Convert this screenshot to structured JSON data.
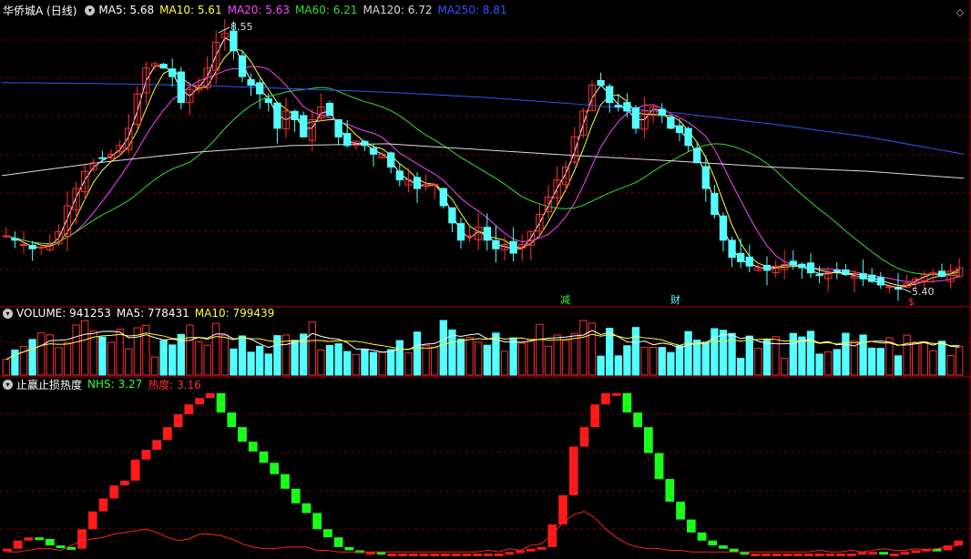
{
  "header": {
    "stock_name": "华侨城A (日线)",
    "ma": [
      {
        "label": "MA5: 5.68",
        "color": "#ffffff"
      },
      {
        "label": "MA10: 5.61",
        "color": "#ffff33"
      },
      {
        "label": "MA20: 5.63",
        "color": "#ff44ff"
      },
      {
        "label": "MA60: 6.21",
        "color": "#33dd33"
      },
      {
        "label": "MA120: 6.72",
        "color": "#dddddd"
      },
      {
        "label": "MA250: 8.81",
        "color": "#3355ff"
      }
    ]
  },
  "volume_header": {
    "label": "VOLUME: 941253",
    "ma5": "MA5: 778431",
    "ma10": "MA10: 799439"
  },
  "indicator_header": {
    "name": "止赢止损热度",
    "nhs": "NHS: 3.27",
    "heat": "热度: 3.16"
  },
  "annotations": {
    "high": "8.55",
    "low": "5.40",
    "event_1": "减",
    "event_2": "财",
    "event_3": "$"
  },
  "colors": {
    "up": "#ff3030",
    "down": "#54ffff",
    "grid": "#7a0000",
    "nhs_up": "#ff1a1a",
    "nhs_down": "#1aff1a",
    "heat": "#ff2020"
  },
  "icons": {
    "settings": "circle-chevron-icon",
    "corner": "diamond-icon"
  },
  "chart_data": [
    {
      "type": "candlestick",
      "title": "华侨城A (日线)",
      "ylim": [
        5.3,
        8.6
      ],
      "price_path": [
        6.05,
        6.0,
        5.95,
        5.9,
        5.92,
        5.95,
        6.1,
        6.4,
        6.6,
        6.8,
        6.9,
        6.95,
        7.0,
        7.1,
        7.3,
        7.7,
        8.0,
        8.05,
        8.0,
        7.9,
        7.6,
        7.75,
        7.8,
        8.0,
        8.3,
        8.4,
        8.2,
        7.9,
        7.8,
        7.7,
        7.6,
        7.3,
        7.5,
        7.4,
        7.2,
        7.4,
        7.55,
        7.45,
        7.2,
        7.1,
        7.15,
        7.1,
        7.0,
        7.0,
        6.85,
        6.7,
        6.7,
        6.6,
        6.65,
        6.65,
        6.4,
        6.2,
        6.0,
        6.05,
        6.15,
        6.0,
        5.9,
        5.95,
        5.85,
        5.95,
        6.1,
        6.3,
        6.5,
        6.7,
        6.85,
        7.2,
        7.5,
        7.8,
        7.8,
        7.6,
        7.55,
        7.5,
        7.3,
        7.5,
        7.55,
        7.45,
        7.3,
        7.25,
        7.1,
        6.9,
        6.6,
        6.3,
        6.0,
        5.8,
        5.75,
        5.7,
        5.68,
        5.65,
        5.7,
        5.72,
        5.71,
        5.68,
        5.62,
        5.6,
        5.62,
        5.64,
        5.6,
        5.58,
        5.55,
        5.52,
        5.48,
        5.46,
        5.44,
        5.5,
        5.55,
        5.6,
        5.62,
        5.58,
        5.64,
        5.68
      ],
      "high": 8.55,
      "low": 5.4
    },
    {
      "type": "bar",
      "title": "VOLUME",
      "values_latest": 941253,
      "ma5": 778431,
      "ma10": 799439
    },
    {
      "type": "line",
      "title": "止赢止损热度",
      "series": [
        {
          "name": "NHS",
          "values": [
            0.3,
            0.8,
            1.0,
            0.9,
            0.5,
            0.4,
            0.3,
            1.5,
            2.6,
            3.4,
            4.2,
            4.5,
            5.8,
            6.4,
            7.0,
            7.8,
            8.6,
            9.2,
            9.6,
            9.9,
            8.7,
            7.8,
            6.9,
            6.3,
            5.6,
            4.9,
            4.0,
            3.1,
            2.5,
            1.5,
            1.0,
            0.4,
            0.2,
            0.1,
            0.1,
            0.0,
            0.0,
            0.0,
            0.0,
            0.0,
            0.0,
            0.0,
            0.0,
            0.0,
            0.0,
            0.0,
            0.0,
            0.1,
            0.2,
            0.3,
            0.4,
            1.8,
            3.6,
            6.6,
            7.8,
            9.2,
            9.9,
            9.9,
            8.7,
            7.8,
            6.2,
            4.6,
            3.2,
            2.1,
            1.3,
            0.8,
            0.5,
            0.3,
            0.1,
            0.0,
            0.0,
            0.0,
            0.0,
            0.0,
            0.0,
            0.0,
            0.0,
            0.0,
            0.0,
            0.0,
            0.1,
            0.1,
            0.0,
            0.0,
            0.1,
            0.2,
            0.3,
            0.2,
            0.5,
            0.8
          ]
        },
        {
          "name": "热度",
          "values": [
            0.1,
            0.1,
            0.2,
            0.3,
            0.3,
            0.2,
            0.5,
            0.8,
            0.9,
            1.0,
            1.2,
            1.3,
            1.4,
            1.5,
            1.3,
            1.0,
            0.8,
            0.9,
            1.2,
            1.2,
            1.1,
            0.9,
            0.6,
            0.4,
            0.3,
            0.3,
            0.4,
            0.4,
            0.4,
            0.2,
            0.2,
            0.1,
            0.1,
            0.1,
            0.1,
            0.1,
            0.1,
            0.1,
            0.1,
            0.1,
            0.1,
            0.1,
            0.1,
            0.1,
            0.1,
            0.2,
            0.1,
            0.3,
            0.2,
            0.5,
            0.6,
            1.2,
            1.9,
            2.4,
            2.6,
            2.2,
            1.5,
            1.0,
            0.6,
            0.4,
            0.3,
            0.3,
            0.2,
            0.2,
            0.1,
            0.1,
            0.1,
            0.1,
            0.1,
            0.1,
            0.1,
            0.1,
            0.1,
            0.1,
            0.1,
            0.1,
            0.2,
            0.1,
            0.1,
            0.2,
            0.1,
            0.2,
            0.3,
            0.2,
            0.2,
            0.3,
            0.2,
            0.3,
            0.4,
            0.5
          ]
        }
      ]
    }
  ]
}
